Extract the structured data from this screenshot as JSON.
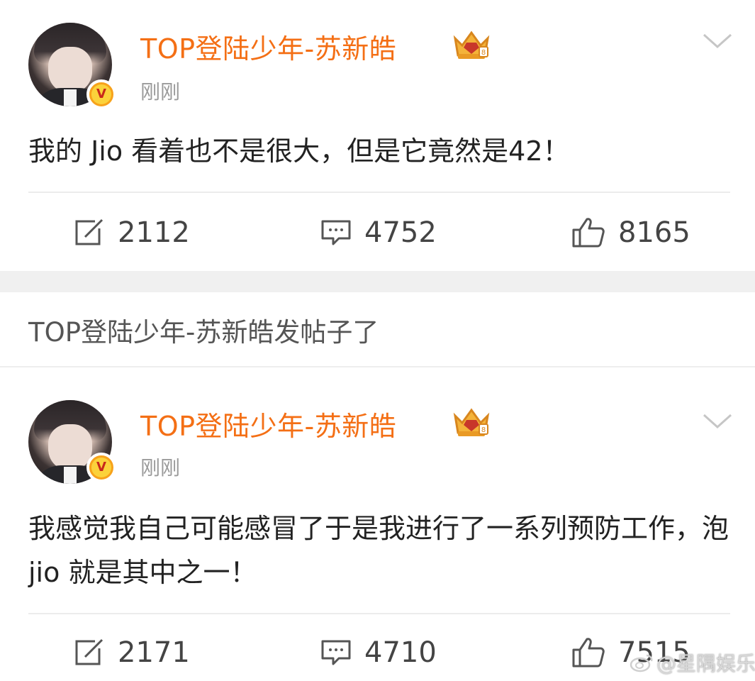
{
  "posts": [
    {
      "username": "TOP登陆少年-苏新皓",
      "time": "刚刚",
      "text": "我的 Jio 看着也不是很大，但是它竟然是42！",
      "repost_count": "2112",
      "comment_count": "4752",
      "like_count": "8165"
    },
    {
      "username": "TOP登陆少年-苏新皓",
      "time": "刚刚",
      "text": "我感觉我自己可能感冒了于是我进行了一系列预防工作，泡 jio 就是其中之一！",
      "repost_count": "2171",
      "comment_count": "4710",
      "like_count": "7515"
    }
  ],
  "notice": "TOP登陆少年-苏新皓发帖子了",
  "watermark": "@星隅娱乐",
  "colors": {
    "username": "#f46f15",
    "time": "#9a9a9a",
    "text": "#222222",
    "separator": "#f0f0f0"
  },
  "icons": {
    "verified": "verified-badge-icon",
    "crown": "crown-vip-icon",
    "more": "chevron-down-icon",
    "repost": "repost-icon",
    "comment": "comment-icon",
    "like": "thumbs-up-icon",
    "watermark": "weibo-logo-icon"
  }
}
